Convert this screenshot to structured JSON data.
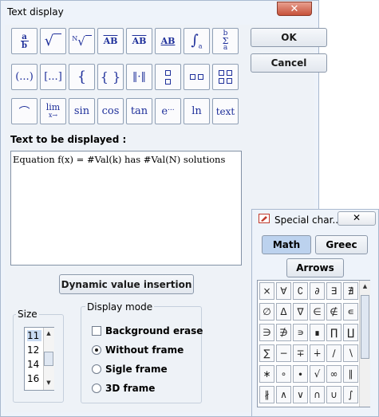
{
  "dialog": {
    "title": "Text display",
    "close_glyph": "✕",
    "ok_label": "OK",
    "cancel_label": "Cancel",
    "formula_buttons": [
      "a/b",
      "√",
      "ⁿ√",
      "AB→",
      "AB̄",
      "AB_",
      "∫",
      "Σ",
      "(...)",
      "[...]",
      "{",
      "{ }",
      "|·|",
      "⋮",
      "▫▫",
      "⁚⁚",
      "⌢",
      "lim",
      "sin",
      "cos",
      "tan",
      "eˣ",
      "ln",
      "text"
    ],
    "text_label": "Text to be displayed :",
    "text_value": "Equation f(x) = #Val(k) has #Val(N) solutions",
    "dynamic_button": "Dynamic value insertion",
    "size_label": "Size",
    "sizes": [
      "11",
      "12",
      "14",
      "16"
    ],
    "selected_size": "11",
    "display_mode_label": "Display mode",
    "background_erase_label": "Background erase",
    "background_erase_checked": false,
    "mode_options": [
      "Without frame",
      "Sigle frame",
      "3D frame"
    ],
    "selected_mode": "Without frame"
  },
  "special_chars": {
    "title": "Special char...",
    "tabs": [
      "Math",
      "Greec",
      "Arrows"
    ],
    "active_tab": "Math",
    "symbols": [
      "×",
      "∀",
      "∁",
      "∂",
      "∃",
      "∄",
      "∅",
      "Δ",
      "∇",
      "∈",
      "∉",
      "∊",
      "∋",
      "∌",
      "∍",
      "∎",
      "∏",
      "∐",
      "∑",
      "−",
      "∓",
      "∔",
      "∕",
      "∖",
      "∗",
      "∘",
      "∙",
      "√",
      "∞",
      "∥",
      "∦",
      "∧",
      "∨",
      "∩",
      "∪",
      "∫"
    ]
  }
}
